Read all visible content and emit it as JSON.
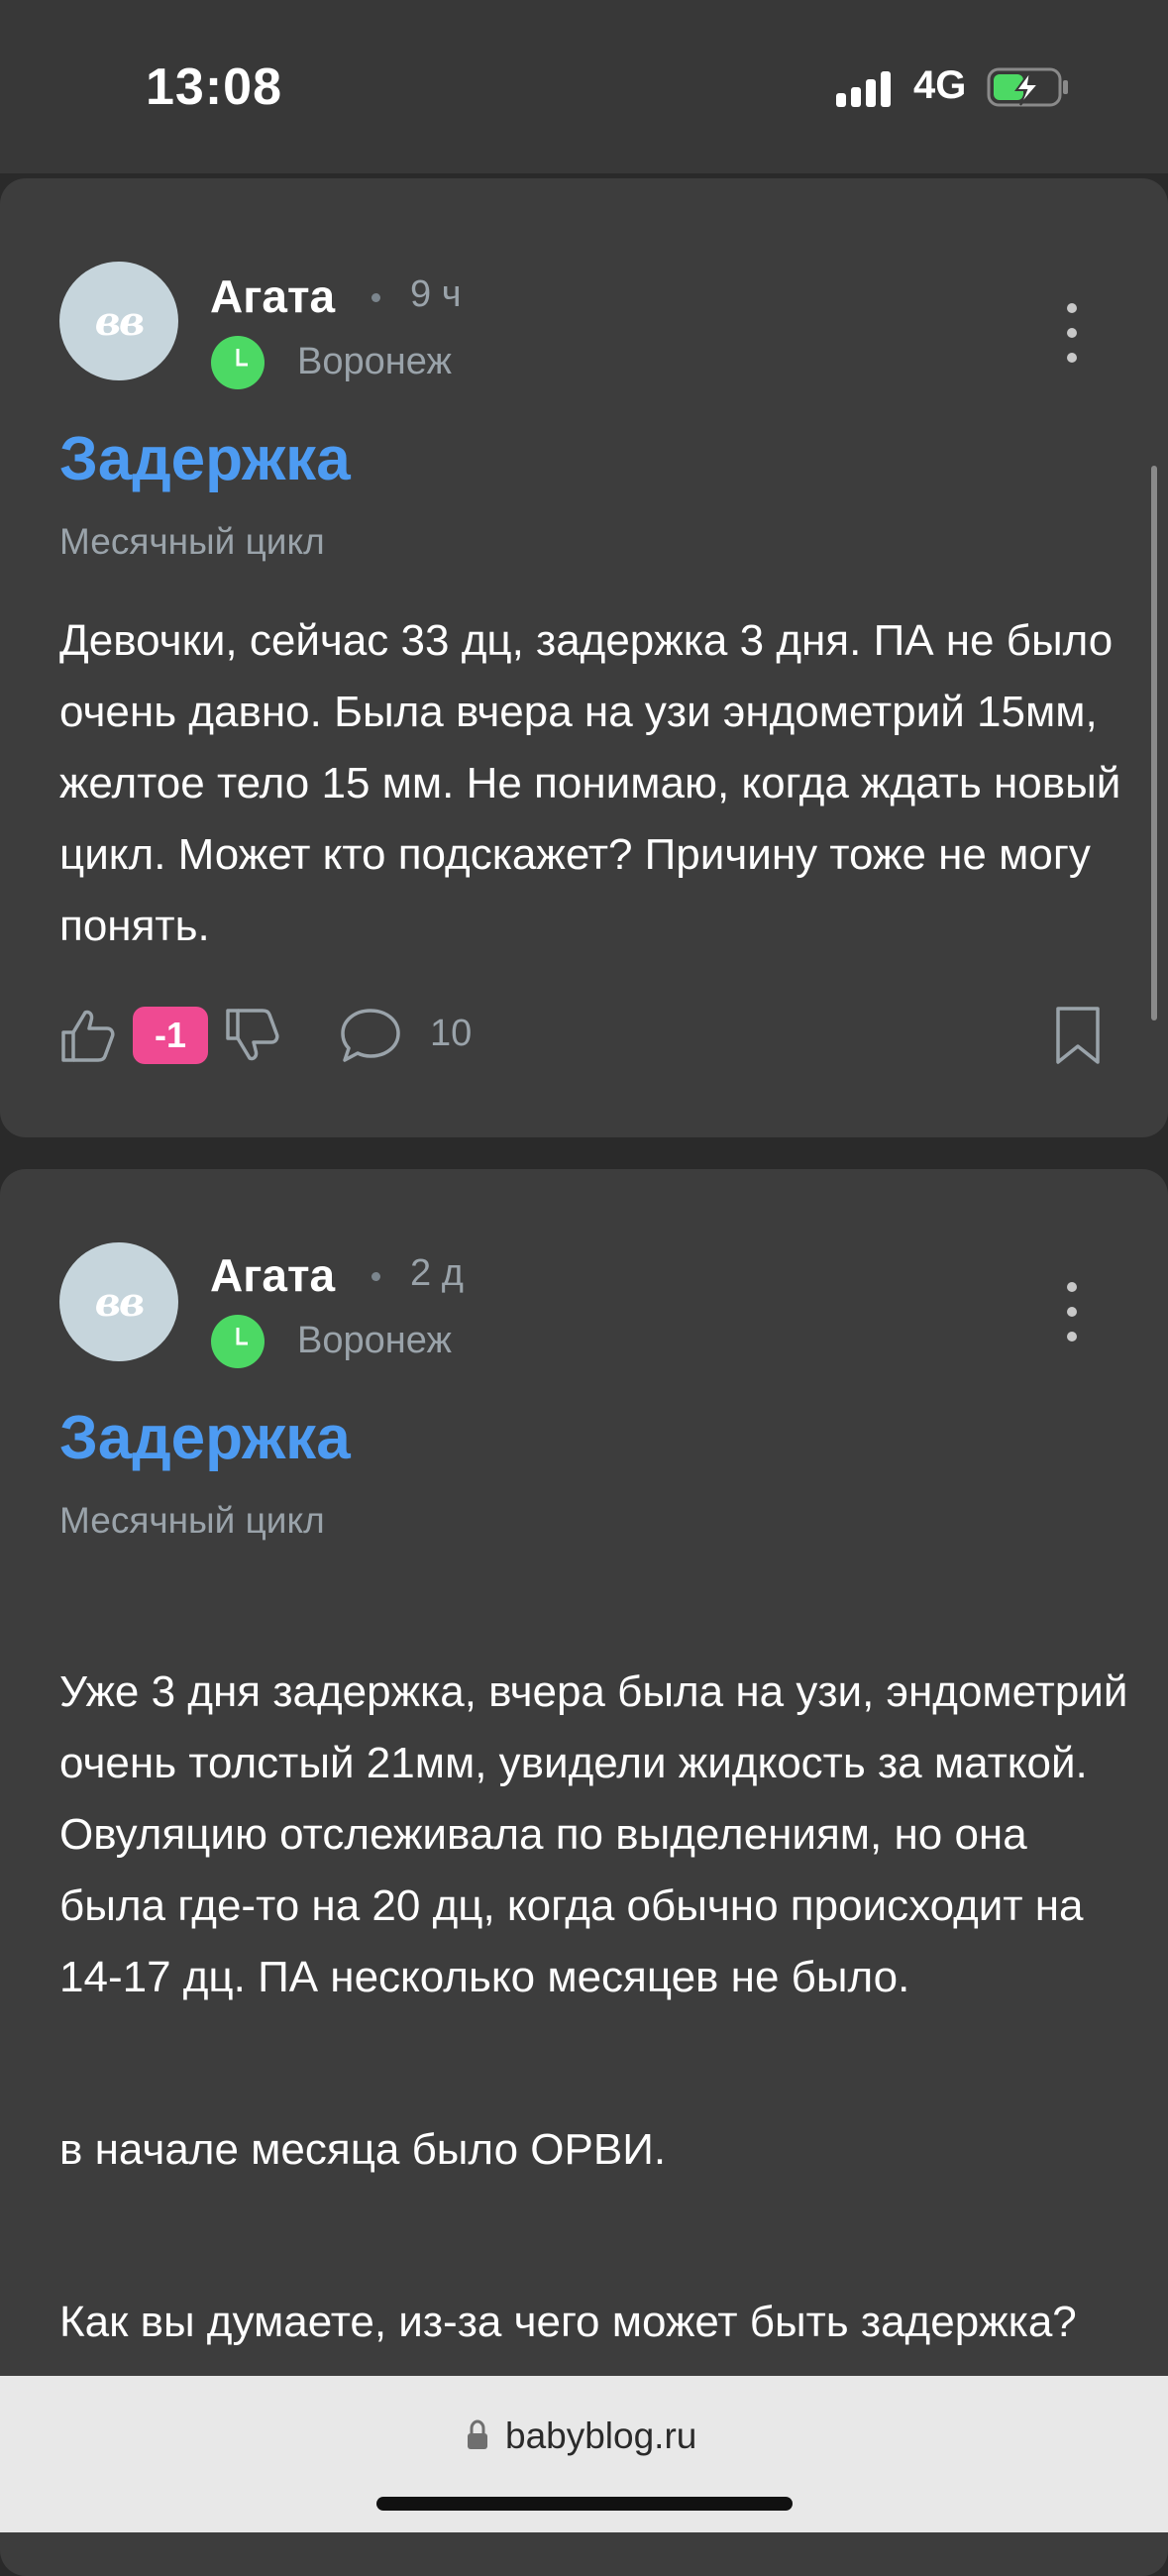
{
  "status_bar": {
    "time": "13:08",
    "network": "4G",
    "signal_icon": "signal-bars-icon",
    "battery_icon": "battery-charging-icon",
    "battery_color": "#4cd964"
  },
  "posts": [
    {
      "avatar_text": "вв",
      "author": "Агата",
      "time_ago": "9 ч",
      "city": "Воронеж",
      "title": "Задержка",
      "category": "Месячный цикл",
      "paragraphs": [
        "Девочки, сейчас 33 дц, задержка 3 дня. ПА не было очень давно. Была вчера на узи эндометрий 15мм, желтое тело 15 мм. Не понимаю, когда ждать новый цикл. Может кто подскажет? Причину тоже не могу понять."
      ],
      "rating": "-1",
      "comments": "10"
    },
    {
      "avatar_text": "вв",
      "author": "Агата",
      "time_ago": "2 д",
      "city": "Воронеж",
      "title": "Задержка",
      "category": "Месячный цикл",
      "paragraphs": [
        "Уже 3 дня задержка, вчера была на узи, эндометрий очень толстый 21мм, увидели жидкость за маткой.\nОвуляцию отслеживала по выделениям, но она была где-то на 20 дц, когда обычно происходит на 14-17 дц. ПА несколько месяцев не было.",
        "в начале месяца было ОРВИ.",
        "Как вы думаете, из-за чего может быть задержка?"
      ]
    }
  ],
  "browser": {
    "url": "babyblog.ru",
    "lock_icon": "lock-icon"
  },
  "colors": {
    "title": "#4d9bf2",
    "badge": "#ef4a92",
    "card": "#3d3d3d",
    "background": "#2a2a2a"
  }
}
